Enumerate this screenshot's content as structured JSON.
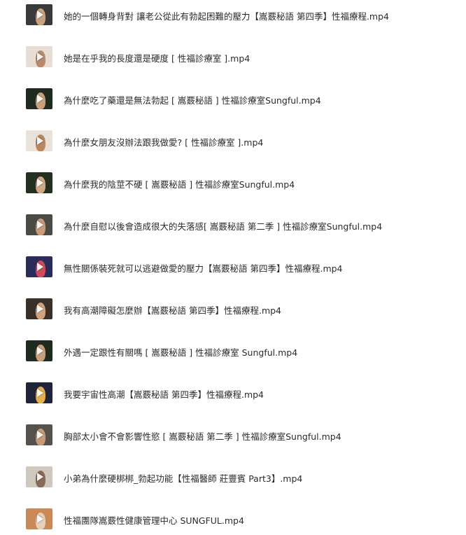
{
  "files": [
    {
      "name": "她的一個轉身背對  讓老公從此有勃起困難的壓力【嵩覈秘語 第四季】性福療程.mp4",
      "icon": "video-thumbnail-icon",
      "thumb_bg": "#3a3a3a",
      "thumb_accent": "#caa27c"
    },
    {
      "name": "她是在乎我的長度還是硬度 [ 性福診療室 ].mp4",
      "icon": "video-thumbnail-icon",
      "thumb_bg": "#e7ddd3",
      "thumb_accent": "#b98a6a"
    },
    {
      "name": "為什麼吃了藥還是無法勃起  [ 嵩覈秘語 ] 性福診療室Sungful.mp4",
      "icon": "video-thumbnail-icon",
      "thumb_bg": "#1f2a20",
      "thumb_accent": "#c9a07a"
    },
    {
      "name": "為什麼女朋友沒辦法跟我做愛? [ 性福診療室 ].mp4",
      "icon": "video-thumbnail-icon",
      "thumb_bg": "#e9e2da",
      "thumb_accent": "#b8865f"
    },
    {
      "name": "為什麼我的陰莖不硬  [ 嵩覈秘語 ] 性福診療室Sungful.mp4",
      "icon": "video-thumbnail-icon",
      "thumb_bg": "#23301f",
      "thumb_accent": "#d0a884"
    },
    {
      "name": "為什麼自慰以後會造成很大的失落感[ 嵩覈秘語 第二季 ] 性福診療室Sungful.mp4",
      "icon": "video-thumbnail-icon",
      "thumb_bg": "#4b4b46",
      "thumb_accent": "#c89c78"
    },
    {
      "name": "無性關係裝死就可以逃避做愛的壓力【嵩覈秘語 第四季】性福療程.mp4",
      "icon": "video-thumbnail-icon",
      "thumb_bg": "#2a2d5a",
      "thumb_accent": "#d14a5a"
    },
    {
      "name": "我有高潮障礙怎麼辦【嵩覈秘語 第四季】性福療程.mp4",
      "icon": "video-thumbnail-icon",
      "thumb_bg": "#3b2f2a",
      "thumb_accent": "#d2a27c"
    },
    {
      "name": "外遇一定跟性有關嗎  [ 嵩覈秘語 ] 性福診療室 Sungful.mp4",
      "icon": "video-thumbnail-icon",
      "thumb_bg": "#1f2b1e",
      "thumb_accent": "#caa07c"
    },
    {
      "name": "我要宇宙性高潮【嵩覈秘語 第四季】性福療程.mp4",
      "icon": "video-thumbnail-icon",
      "thumb_bg": "#20233a",
      "thumb_accent": "#e3b04b"
    },
    {
      "name": "胸部太小會不會影響性慾 [ 嵩覈秘語 第二季 ] 性福診療室Sungful.mp4",
      "icon": "video-thumbnail-icon",
      "thumb_bg": "#55524d",
      "thumb_accent": "#c89a78"
    },
    {
      "name": "小弟為什麼硬梆梆_勃起功能【性福醫師 莊豐賓 Part3】.mp4",
      "icon": "video-thumbnail-icon",
      "thumb_bg": "#cfc8bd",
      "thumb_accent": "#8a6a58"
    },
    {
      "name": "性福團隊嵩覈性健康管理中心 SUNGFUL.mp4",
      "icon": "video-thumbnail-icon",
      "thumb_bg": "#c98a5a",
      "thumb_accent": "#e8d0b8"
    }
  ]
}
